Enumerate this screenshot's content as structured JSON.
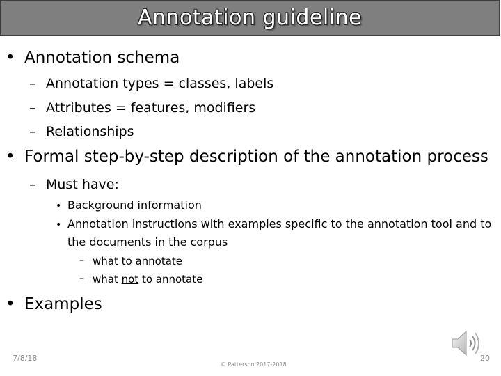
{
  "slide": {
    "title": "Annotation guideline",
    "bullets": {
      "b1": "Annotation schema",
      "b1_1": "Annotation types = classes, labels",
      "b1_2": "Attributes = features, modifiers",
      "b1_3": "Relationships",
      "b2": "Formal step-by-step description of the annotation process",
      "b2_1": "Must have:",
      "b2_1_1": "Background information",
      "b2_1_2": "Annotation instructions with examples specific to the annotation tool and to the documents in the corpus",
      "b2_1_2_1": "what to annotate",
      "b2_1_2_2_pre": "what ",
      "b2_1_2_2_em": "not",
      "b2_1_2_2_post": " to annotate",
      "b3": "Examples"
    },
    "markers": {
      "bullet": "•",
      "dash": "–"
    }
  },
  "footer": {
    "date": "7/8/18",
    "copyright": "© Patterson 2017-2018",
    "page_number": "20"
  },
  "icons": {
    "audio": "speaker-icon"
  },
  "colors": {
    "title_bar": "#7f7f7f",
    "title_text": "#ffffff",
    "footer_text": "#8c8c8c"
  }
}
